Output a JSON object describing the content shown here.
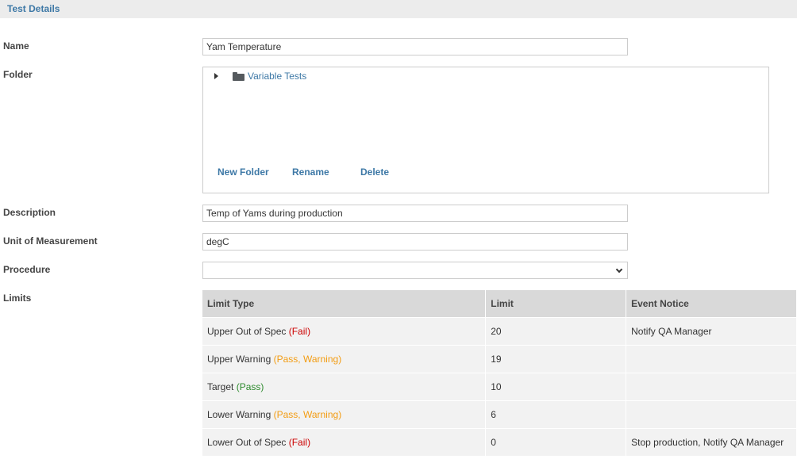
{
  "section": {
    "title": "Test Details"
  },
  "colors": {
    "accent": "#3d78a6",
    "fail": "#cc0000",
    "warning": "#f39c12",
    "pass": "#2d8a2d"
  },
  "form": {
    "name_label": "Name",
    "name_value": "Yam Temperature",
    "folder_label": "Folder",
    "description_label": "Description",
    "description_value": "Temp of Yams during production",
    "unit_label": "Unit of Measurement",
    "unit_value": "degC",
    "procedure_label": "Procedure",
    "procedure_value": "",
    "limits_label": "Limits"
  },
  "folder": {
    "tree": [
      {
        "label": "Variable Tests",
        "icon": "folder-icon",
        "expanded": false
      }
    ],
    "actions": {
      "new_folder": "New Folder",
      "rename": "Rename",
      "delete": "Delete"
    }
  },
  "limits": {
    "headers": {
      "type": "Limit Type",
      "limit": "Limit",
      "notice": "Event Notice"
    },
    "rows": [
      {
        "type": "Upper Out of Spec",
        "status": "(Fail)",
        "limit": "20",
        "notice": "Notify QA Manager"
      },
      {
        "type": "Upper Warning",
        "status": "(Pass, Warning)",
        "limit": "19",
        "notice": ""
      },
      {
        "type": "Target",
        "status": "(Pass)",
        "limit": "10",
        "notice": ""
      },
      {
        "type": "Lower Warning",
        "status": "(Pass, Warning)",
        "limit": "6",
        "notice": ""
      },
      {
        "type": "Lower Out of Spec",
        "status": "(Fail)",
        "limit": "0",
        "notice": "Stop production, Notify QA Manager"
      }
    ]
  }
}
